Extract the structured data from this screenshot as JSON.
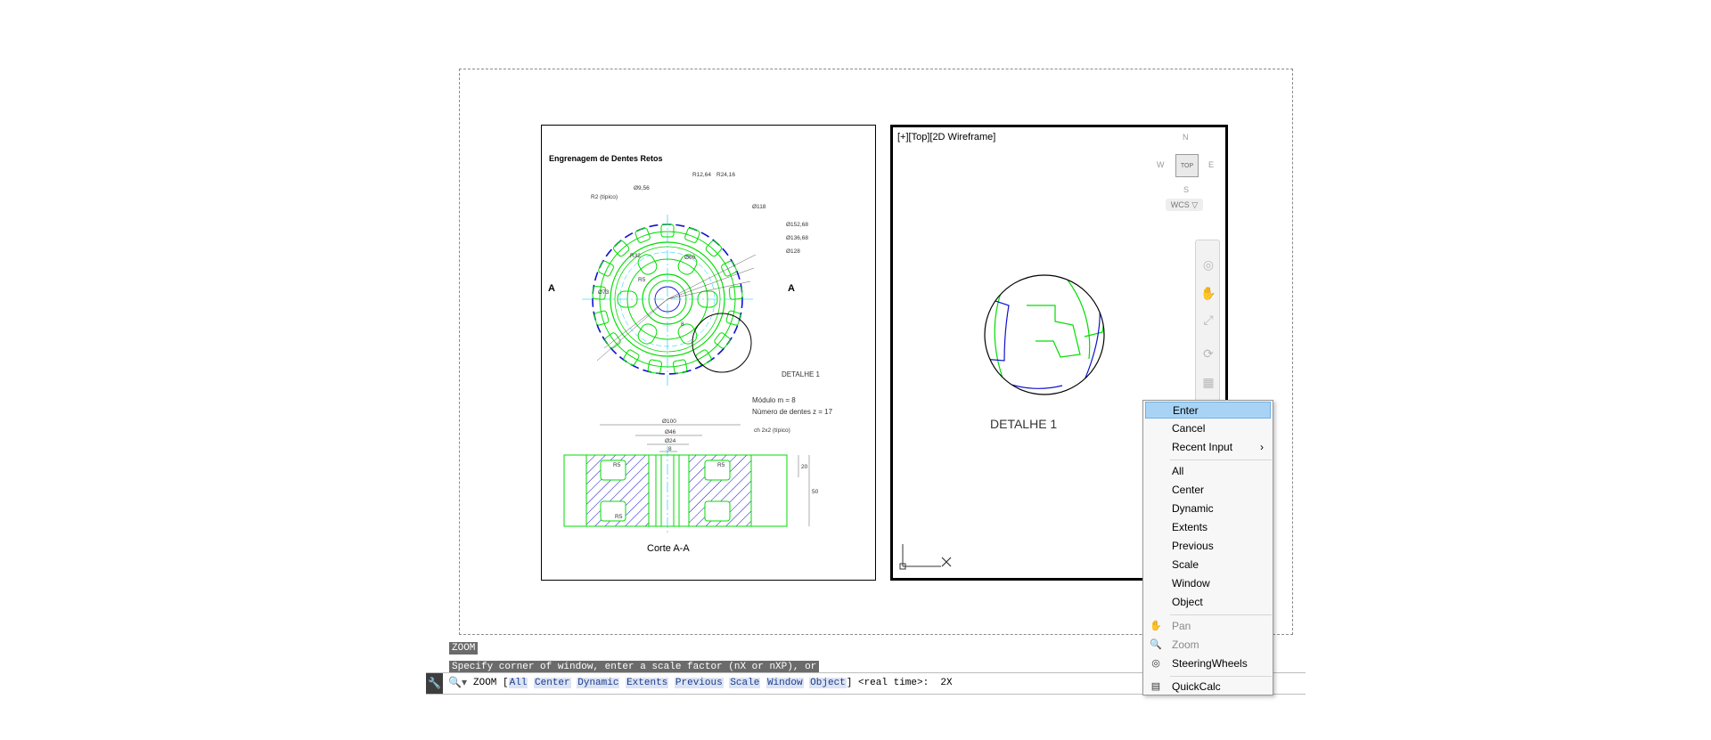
{
  "drawing_sheet": {
    "title": "Engrenagem de Dentes Retos",
    "labels": {
      "r12": "R12,64",
      "r24": "R24,16",
      "r2": "R2 (típico)",
      "d956": "Ø9,56",
      "d118": "Ø118",
      "d152": "Ø152,68",
      "d136": "Ø136,68",
      "d128": "Ø128",
      "r32": "R32",
      "r5a": "R5",
      "d60": "Ø60",
      "d73": "Ø73",
      "eight": "8",
      "sec_a_left": "A",
      "sec_a_right": "A",
      "detail": "DETALHE 1",
      "modulo": "Módulo m = 8",
      "dentes": "Número de dentes z = 17",
      "d100": "Ø100",
      "d46": "Ø46",
      "d24": "Ø24",
      "d8": "8",
      "chamfer": "ch 2x2 (típico)",
      "r5_1": "R5",
      "r5_2": "R5",
      "r5_3": "R5",
      "dim20": "20",
      "dim50": "50",
      "section_title": "Corte A-A"
    }
  },
  "viewport": {
    "label": "[+][Top][2D Wireframe]",
    "detail_caption": "DETALHE 1",
    "viewcube": {
      "north": "N",
      "south": "S",
      "east": "E",
      "west": "W",
      "face": "TOP",
      "ucs": "WCS ▽"
    },
    "navbar_icons": [
      "steering-wheel",
      "pan",
      "zoom-extents",
      "orbit",
      "showmotion"
    ]
  },
  "command_history": {
    "line1": "ZOOM",
    "line2": "Specify corner of window, enter a scale factor (nX or nXP), or"
  },
  "command_line": {
    "command": "ZOOM [",
    "options": [
      "All",
      "Center",
      "Dynamic",
      "Extents",
      "Previous",
      "Scale",
      "Window",
      "Object"
    ],
    "tail": "] <real time>:  2X"
  },
  "context_menu": {
    "items": [
      {
        "label": "Enter",
        "highlighted": true
      },
      {
        "label": "Cancel"
      },
      {
        "label": "Recent Input",
        "submenu": "›"
      },
      {
        "label": "All"
      },
      {
        "label": "Center"
      },
      {
        "label": "Dynamic"
      },
      {
        "label": "Extents"
      },
      {
        "label": "Previous"
      },
      {
        "label": "Scale"
      },
      {
        "label": "Window"
      },
      {
        "label": "Object"
      },
      {
        "label": "Pan",
        "disabled": true,
        "icon": "pan-icon"
      },
      {
        "label": "Zoom",
        "disabled": true,
        "icon": "zoom-icon"
      },
      {
        "label": "SteeringWheels",
        "icon": "steering-wheel-icon"
      },
      {
        "label": "QuickCalc",
        "icon": "calculator-icon"
      }
    ]
  },
  "colors": {
    "green": "#00dd00",
    "blue": "#1010d0",
    "cyan": "#00c8ff",
    "highlight": "#a9d3f5"
  }
}
